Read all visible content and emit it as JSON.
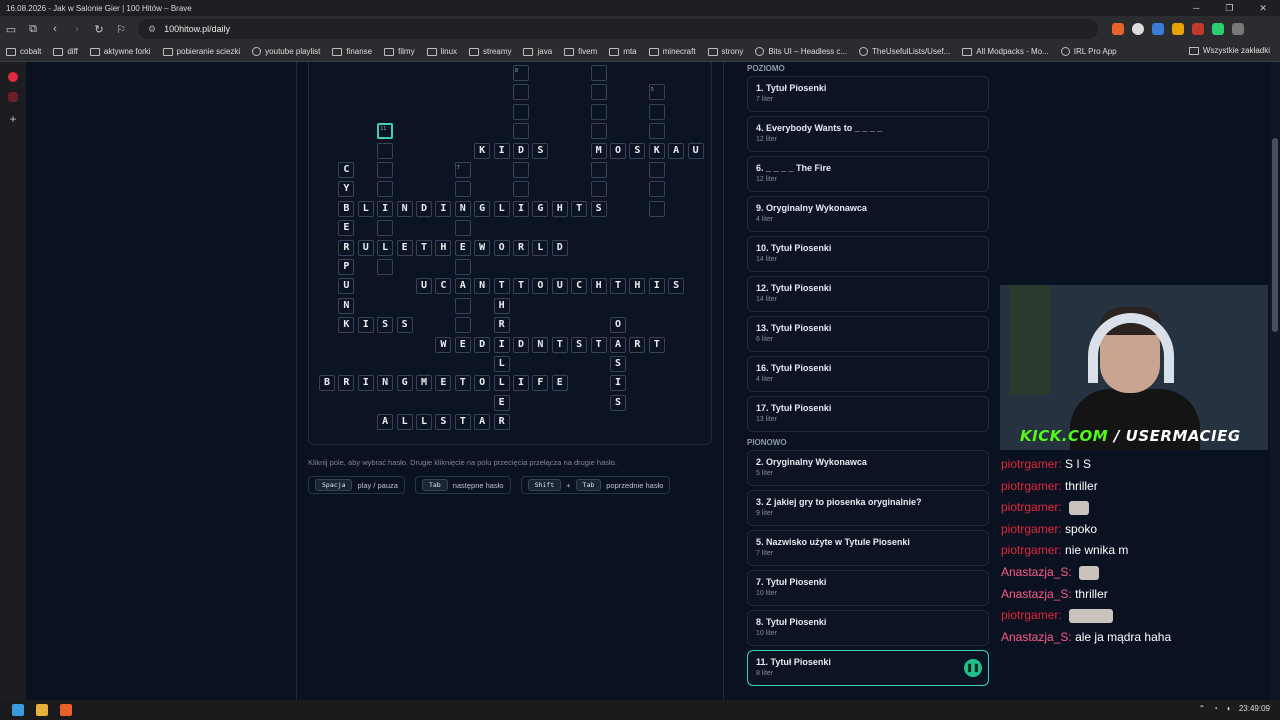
{
  "window": {
    "title": "16.08.2026 - Jak w Salonie Gier | 100 Hitów – Brave",
    "url": "100hitow.pl/daily"
  },
  "bookmarks": [
    {
      "label": "cobalt",
      "icon": "cobalt-icon"
    },
    {
      "label": "diff",
      "icon": "diff-icon"
    },
    {
      "label": "aktywne forki",
      "icon": "folder-icon"
    },
    {
      "label": "pobieranie sciezki",
      "icon": "page-icon"
    },
    {
      "label": "youtube playlist",
      "icon": "globe-icon"
    },
    {
      "label": "finanse",
      "icon": "folder-icon"
    },
    {
      "label": "filmy",
      "icon": "folder-icon"
    },
    {
      "label": "linux",
      "icon": "folder-icon"
    },
    {
      "label": "streamy",
      "icon": "folder-icon"
    },
    {
      "label": "java",
      "icon": "folder-icon"
    },
    {
      "label": "fivem",
      "icon": "folder-icon"
    },
    {
      "label": "mta",
      "icon": "folder-icon"
    },
    {
      "label": "minecraft",
      "icon": "folder-icon"
    },
    {
      "label": "strony",
      "icon": "folder-icon"
    },
    {
      "label": "Bits UI – Headless c...",
      "icon": "globe-icon"
    },
    {
      "label": "TheUsefulLists/Usef...",
      "icon": "github-icon"
    },
    {
      "label": "All Modpacks - Mo...",
      "icon": "page-icon"
    },
    {
      "label": "IRL Pro App",
      "icon": "globe-icon"
    }
  ],
  "bookmarks_all": "Wszystkie zakładki",
  "crossword": {
    "hint": "Kliknij pole, aby wybrać hasło. Drugie kliknięcie na polu przecięcia przełącza na drugie hasło.",
    "shortcuts": [
      {
        "keys": [
          "Spacja"
        ],
        "desc": "play / pauza"
      },
      {
        "keys": [
          "Tab"
        ],
        "desc": "następne hasło"
      },
      {
        "keys": [
          "Shift",
          "Tab"
        ],
        "desc": "poprzednie hasło"
      }
    ],
    "plus": "+",
    "cells": [
      {
        "c": 10,
        "r": 0,
        "ch": "",
        "n": "8"
      },
      {
        "c": 14,
        "r": 0,
        "ch": ""
      },
      {
        "c": 10,
        "r": 1,
        "ch": ""
      },
      {
        "c": 14,
        "r": 1,
        "ch": ""
      },
      {
        "c": 17,
        "r": 1,
        "ch": "",
        "n": "5"
      },
      {
        "c": 10,
        "r": 2,
        "ch": ""
      },
      {
        "c": 14,
        "r": 2,
        "ch": ""
      },
      {
        "c": 17,
        "r": 2,
        "ch": ""
      },
      {
        "c": 3,
        "r": 3,
        "ch": "",
        "n": "11",
        "sel": true
      },
      {
        "c": 10,
        "r": 3,
        "ch": ""
      },
      {
        "c": 14,
        "r": 3,
        "ch": ""
      },
      {
        "c": 17,
        "r": 3,
        "ch": ""
      },
      {
        "c": 3,
        "r": 4,
        "ch": ""
      },
      {
        "c": 8,
        "r": 4,
        "ch": "K"
      },
      {
        "c": 9,
        "r": 4,
        "ch": "I"
      },
      {
        "c": 10,
        "r": 4,
        "ch": "D"
      },
      {
        "c": 11,
        "r": 4,
        "ch": "S"
      },
      {
        "c": 14,
        "r": 4,
        "ch": "M"
      },
      {
        "c": 15,
        "r": 4,
        "ch": "O"
      },
      {
        "c": 16,
        "r": 4,
        "ch": "S"
      },
      {
        "c": 17,
        "r": 4,
        "ch": "K"
      },
      {
        "c": 18,
        "r": 4,
        "ch": "A"
      },
      {
        "c": 19,
        "r": 4,
        "ch": "U"
      },
      {
        "c": 1,
        "r": 5,
        "ch": "C"
      },
      {
        "c": 3,
        "r": 5,
        "ch": ""
      },
      {
        "c": 7,
        "r": 5,
        "ch": "",
        "n": "7"
      },
      {
        "c": 10,
        "r": 5,
        "ch": ""
      },
      {
        "c": 14,
        "r": 5,
        "ch": ""
      },
      {
        "c": 17,
        "r": 5,
        "ch": ""
      },
      {
        "c": 1,
        "r": 6,
        "ch": "Y"
      },
      {
        "c": 3,
        "r": 6,
        "ch": ""
      },
      {
        "c": 7,
        "r": 6,
        "ch": ""
      },
      {
        "c": 10,
        "r": 6,
        "ch": ""
      },
      {
        "c": 14,
        "r": 6,
        "ch": ""
      },
      {
        "c": 17,
        "r": 6,
        "ch": ""
      },
      {
        "c": 1,
        "r": 7,
        "ch": "B"
      },
      {
        "c": 2,
        "r": 7,
        "ch": "L"
      },
      {
        "c": 3,
        "r": 7,
        "ch": "I"
      },
      {
        "c": 4,
        "r": 7,
        "ch": "N"
      },
      {
        "c": 5,
        "r": 7,
        "ch": "D"
      },
      {
        "c": 6,
        "r": 7,
        "ch": "I"
      },
      {
        "c": 7,
        "r": 7,
        "ch": "N"
      },
      {
        "c": 8,
        "r": 7,
        "ch": "G"
      },
      {
        "c": 9,
        "r": 7,
        "ch": "L"
      },
      {
        "c": 10,
        "r": 7,
        "ch": "I"
      },
      {
        "c": 11,
        "r": 7,
        "ch": "G"
      },
      {
        "c": 12,
        "r": 7,
        "ch": "H"
      },
      {
        "c": 13,
        "r": 7,
        "ch": "T"
      },
      {
        "c": 14,
        "r": 7,
        "ch": "S"
      },
      {
        "c": 17,
        "r": 7,
        "ch": ""
      },
      {
        "c": 1,
        "r": 8,
        "ch": "E"
      },
      {
        "c": 3,
        "r": 8,
        "ch": ""
      },
      {
        "c": 7,
        "r": 8,
        "ch": ""
      },
      {
        "c": 1,
        "r": 9,
        "ch": "R"
      },
      {
        "c": 2,
        "r": 9,
        "ch": "U"
      },
      {
        "c": 3,
        "r": 9,
        "ch": "L"
      },
      {
        "c": 4,
        "r": 9,
        "ch": "E"
      },
      {
        "c": 5,
        "r": 9,
        "ch": "T"
      },
      {
        "c": 6,
        "r": 9,
        "ch": "H"
      },
      {
        "c": 7,
        "r": 9,
        "ch": "E"
      },
      {
        "c": 8,
        "r": 9,
        "ch": "W"
      },
      {
        "c": 9,
        "r": 9,
        "ch": "O"
      },
      {
        "c": 10,
        "r": 9,
        "ch": "R"
      },
      {
        "c": 11,
        "r": 9,
        "ch": "L"
      },
      {
        "c": 12,
        "r": 9,
        "ch": "D"
      },
      {
        "c": 1,
        "r": 10,
        "ch": "P"
      },
      {
        "c": 3,
        "r": 10,
        "ch": ""
      },
      {
        "c": 7,
        "r": 10,
        "ch": ""
      },
      {
        "c": 1,
        "r": 11,
        "ch": "U"
      },
      {
        "c": 5,
        "r": 11,
        "ch": "U"
      },
      {
        "c": 6,
        "r": 11,
        "ch": "C"
      },
      {
        "c": 7,
        "r": 11,
        "ch": "A"
      },
      {
        "c": 8,
        "r": 11,
        "ch": "N"
      },
      {
        "c": 9,
        "r": 11,
        "ch": "T"
      },
      {
        "c": 10,
        "r": 11,
        "ch": "T"
      },
      {
        "c": 11,
        "r": 11,
        "ch": "O"
      },
      {
        "c": 12,
        "r": 11,
        "ch": "U"
      },
      {
        "c": 13,
        "r": 11,
        "ch": "C"
      },
      {
        "c": 14,
        "r": 11,
        "ch": "H"
      },
      {
        "c": 15,
        "r": 11,
        "ch": "T"
      },
      {
        "c": 16,
        "r": 11,
        "ch": "H"
      },
      {
        "c": 17,
        "r": 11,
        "ch": "I"
      },
      {
        "c": 18,
        "r": 11,
        "ch": "S"
      },
      {
        "c": 1,
        "r": 12,
        "ch": "N"
      },
      {
        "c": 7,
        "r": 12,
        "ch": ""
      },
      {
        "c": 9,
        "r": 12,
        "ch": "H"
      },
      {
        "c": 1,
        "r": 13,
        "ch": "K"
      },
      {
        "c": 2,
        "r": 13,
        "ch": "I"
      },
      {
        "c": 3,
        "r": 13,
        "ch": "S"
      },
      {
        "c": 4,
        "r": 13,
        "ch": "S"
      },
      {
        "c": 7,
        "r": 13,
        "ch": ""
      },
      {
        "c": 9,
        "r": 13,
        "ch": "R"
      },
      {
        "c": 15,
        "r": 13,
        "ch": "O"
      },
      {
        "c": 6,
        "r": 14,
        "ch": "W"
      },
      {
        "c": 7,
        "r": 14,
        "ch": "E"
      },
      {
        "c": 8,
        "r": 14,
        "ch": "D"
      },
      {
        "c": 9,
        "r": 14,
        "ch": "I"
      },
      {
        "c": 10,
        "r": 14,
        "ch": "D"
      },
      {
        "c": 11,
        "r": 14,
        "ch": "N"
      },
      {
        "c": 12,
        "r": 14,
        "ch": "T"
      },
      {
        "c": 13,
        "r": 14,
        "ch": "S"
      },
      {
        "c": 14,
        "r": 14,
        "ch": "T"
      },
      {
        "c": 15,
        "r": 14,
        "ch": "A"
      },
      {
        "c": 16,
        "r": 14,
        "ch": "R"
      },
      {
        "c": 17,
        "r": 14,
        "ch": "T"
      },
      {
        "c": 9,
        "r": 15,
        "ch": "L"
      },
      {
        "c": 15,
        "r": 15,
        "ch": "S"
      },
      {
        "c": 0,
        "r": 16,
        "ch": "B"
      },
      {
        "c": 1,
        "r": 16,
        "ch": "R"
      },
      {
        "c": 2,
        "r": 16,
        "ch": "I"
      },
      {
        "c": 3,
        "r": 16,
        "ch": "N"
      },
      {
        "c": 4,
        "r": 16,
        "ch": "G"
      },
      {
        "c": 5,
        "r": 16,
        "ch": "M"
      },
      {
        "c": 6,
        "r": 16,
        "ch": "E"
      },
      {
        "c": 7,
        "r": 16,
        "ch": "T"
      },
      {
        "c": 8,
        "r": 16,
        "ch": "O"
      },
      {
        "c": 9,
        "r": 16,
        "ch": "L"
      },
      {
        "c": 10,
        "r": 16,
        "ch": "I"
      },
      {
        "c": 11,
        "r": 16,
        "ch": "F"
      },
      {
        "c": 12,
        "r": 16,
        "ch": "E"
      },
      {
        "c": 15,
        "r": 16,
        "ch": "I"
      },
      {
        "c": 9,
        "r": 17,
        "ch": "E"
      },
      {
        "c": 15,
        "r": 17,
        "ch": "S"
      },
      {
        "c": 3,
        "r": 18,
        "ch": "A"
      },
      {
        "c": 4,
        "r": 18,
        "ch": "L"
      },
      {
        "c": 5,
        "r": 18,
        "ch": "L"
      },
      {
        "c": 6,
        "r": 18,
        "ch": "S"
      },
      {
        "c": 7,
        "r": 18,
        "ch": "T"
      },
      {
        "c": 8,
        "r": 18,
        "ch": "A"
      },
      {
        "c": 9,
        "r": 18,
        "ch": "R"
      }
    ]
  },
  "clues": {
    "poziomo_label": "POZIOMO",
    "pionowo_label": "PIONOWO",
    "poziomo": [
      {
        "title": "1. Tytuł Piosenki",
        "len": "7 liter"
      },
      {
        "title": "4. Everybody Wants to _ _ _ _",
        "len": "12 liter"
      },
      {
        "title": "6. _ _ _ _ The Fire",
        "len": "12 liter"
      },
      {
        "title": "9. Oryginalny Wykonawca",
        "len": "4 liter"
      },
      {
        "title": "10. Tytuł Piosenki",
        "len": "14 liter"
      },
      {
        "title": "12. Tytuł Piosenki",
        "len": "14 liter"
      },
      {
        "title": "13. Tytuł Piosenki",
        "len": "6 liter"
      },
      {
        "title": "16. Tytuł Piosenki",
        "len": "4 liter"
      },
      {
        "title": "17. Tytuł Piosenki",
        "len": "13 liter"
      }
    ],
    "pionowo": [
      {
        "title": "2. Oryginalny Wykonawca",
        "len": "5 liter"
      },
      {
        "title": "3. Z jakiej gry to piosenka oryginalnie?",
        "len": "9 liter"
      },
      {
        "title": "5. Nazwisko użyte w Tytule Piosenki",
        "len": "7 liter"
      },
      {
        "title": "7. Tytuł Piosenki",
        "len": "10 liter"
      },
      {
        "title": "8. Tytuł Piosenki",
        "len": "10 liter"
      },
      {
        "title": "11. Tytuł Piosenki",
        "len": "8 liter",
        "active": true
      }
    ]
  },
  "stream": {
    "brand_prefix": "KICK.COM",
    "brand_suffix": "/ USERMACIEG"
  },
  "chat": [
    {
      "user": "piotrgamer",
      "msg": "S I S",
      "color": "u1"
    },
    {
      "user": "piotrgamer",
      "msg": "thriller",
      "color": "u1"
    },
    {
      "user": "piotrgamer",
      "msg": "",
      "emote": true,
      "color": "u1"
    },
    {
      "user": "piotrgamer",
      "msg": "spoko",
      "color": "u1"
    },
    {
      "user": "piotrgamer",
      "msg": "nie wnika m",
      "color": "u1"
    },
    {
      "user": "Anastazja_S",
      "msg": "",
      "emote": true,
      "color": "u2"
    },
    {
      "user": "Anastazja_S",
      "msg": "thriller",
      "color": "u2"
    },
    {
      "user": "piotrgamer",
      "msg": "",
      "emote": true,
      "wide": true,
      "color": "u1"
    },
    {
      "user": "Anastazja_S",
      "msg": "ale ja mądra haha",
      "color": "u2"
    }
  ],
  "taskbar": {
    "time": "23:49:09"
  },
  "colors": {
    "accent": "#3ecfb0",
    "play": "#1fbf8a",
    "kick": "#53fc18"
  }
}
